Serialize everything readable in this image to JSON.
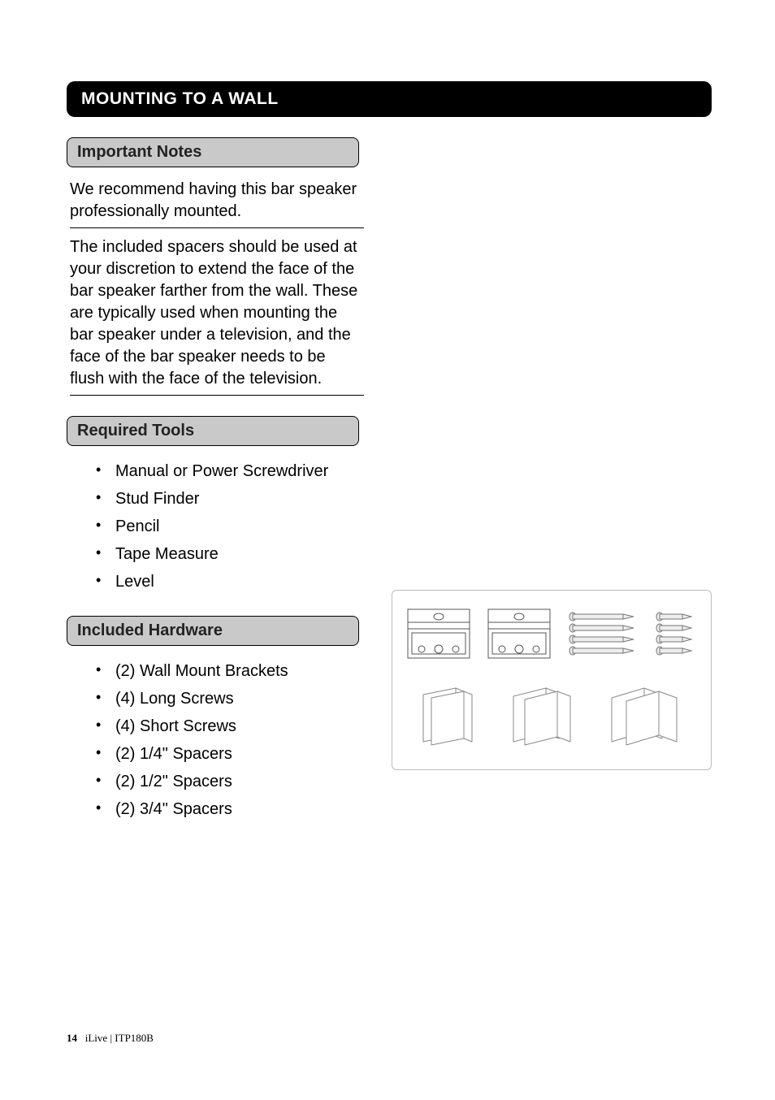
{
  "section_title": "MOUNTING TO A WALL",
  "important_notes": {
    "heading": "Important Notes",
    "para1": "We recommend having this bar speaker professionally mounted.",
    "para2": "The included spacers should be used at your discretion to extend the face of the bar speaker farther from the wall. These are typically used when mounting the bar speaker under a television, and the face of the bar speaker needs to be flush with the face of the television."
  },
  "required_tools": {
    "heading": "Required Tools",
    "items": [
      "Manual or Power Screwdriver",
      "Stud Finder",
      "Pencil",
      "Tape Measure",
      "Level"
    ]
  },
  "included_hardware": {
    "heading": "Included Hardware",
    "items": [
      "(2) Wall Mount Brackets",
      "(4) Long Screws",
      "(4) Short Screws",
      "(2) 1/4\" Spacers",
      "(2) 1/2\" Spacers",
      "(2) 3/4\" Spacers"
    ]
  },
  "footer": {
    "page_num": "14",
    "brand": "iLive",
    "sep": " | ",
    "model": "ITP180B"
  }
}
